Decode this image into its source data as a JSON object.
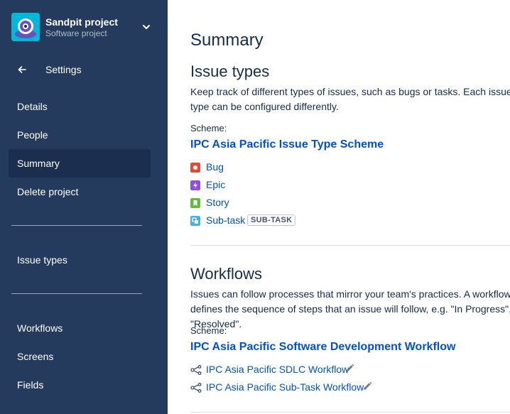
{
  "project": {
    "name": "Sandpit project",
    "type": "Software project"
  },
  "sidebar": {
    "back_label": "Settings",
    "items": [
      {
        "label": "Details"
      },
      {
        "label": "People"
      },
      {
        "label": "Summary",
        "active": true
      },
      {
        "label": "Delete project"
      },
      {
        "label": "Issue types"
      },
      {
        "label": "Workflows"
      },
      {
        "label": "Screens"
      },
      {
        "label": "Fields"
      }
    ]
  },
  "main": {
    "title": "Summary",
    "issue_types": {
      "heading": "Issue types",
      "description": "Keep track of different types of issues, such as bugs or tasks. Each issue type can be configured differently.",
      "scheme_label": "Scheme:",
      "scheme_name": "IPC Asia Pacific Issue Type Scheme",
      "types": [
        {
          "label": "Bug",
          "icon": "bug-icon",
          "color": "#e5493a"
        },
        {
          "label": "Epic",
          "icon": "epic-icon",
          "color": "#904ee2"
        },
        {
          "label": "Story",
          "icon": "story-icon",
          "color": "#63ba3c"
        },
        {
          "label": "Sub-task",
          "icon": "subtask-icon",
          "color": "#4bade8",
          "badge": "SUB-TASK"
        }
      ]
    },
    "workflows": {
      "heading": "Workflows",
      "description": "Issues can follow processes that mirror your team's practices. A workflow defines the sequence of steps that an issue will follow, e.g. \"In Progress\", \"Resolved\".",
      "scheme_label": "Scheme:",
      "scheme_name": "IPC Asia Pacific Software Development Workflow",
      "items": [
        {
          "label": "IPC Asia Pacific SDLC Workflow"
        },
        {
          "label": "IPC Asia Pacific Sub-Task Workflow"
        }
      ]
    }
  },
  "colors": {
    "sidebar_bg": "#243b5e",
    "sidebar_active": "#1b2e4f",
    "link": "#0052cc",
    "text": "#172b4d"
  }
}
